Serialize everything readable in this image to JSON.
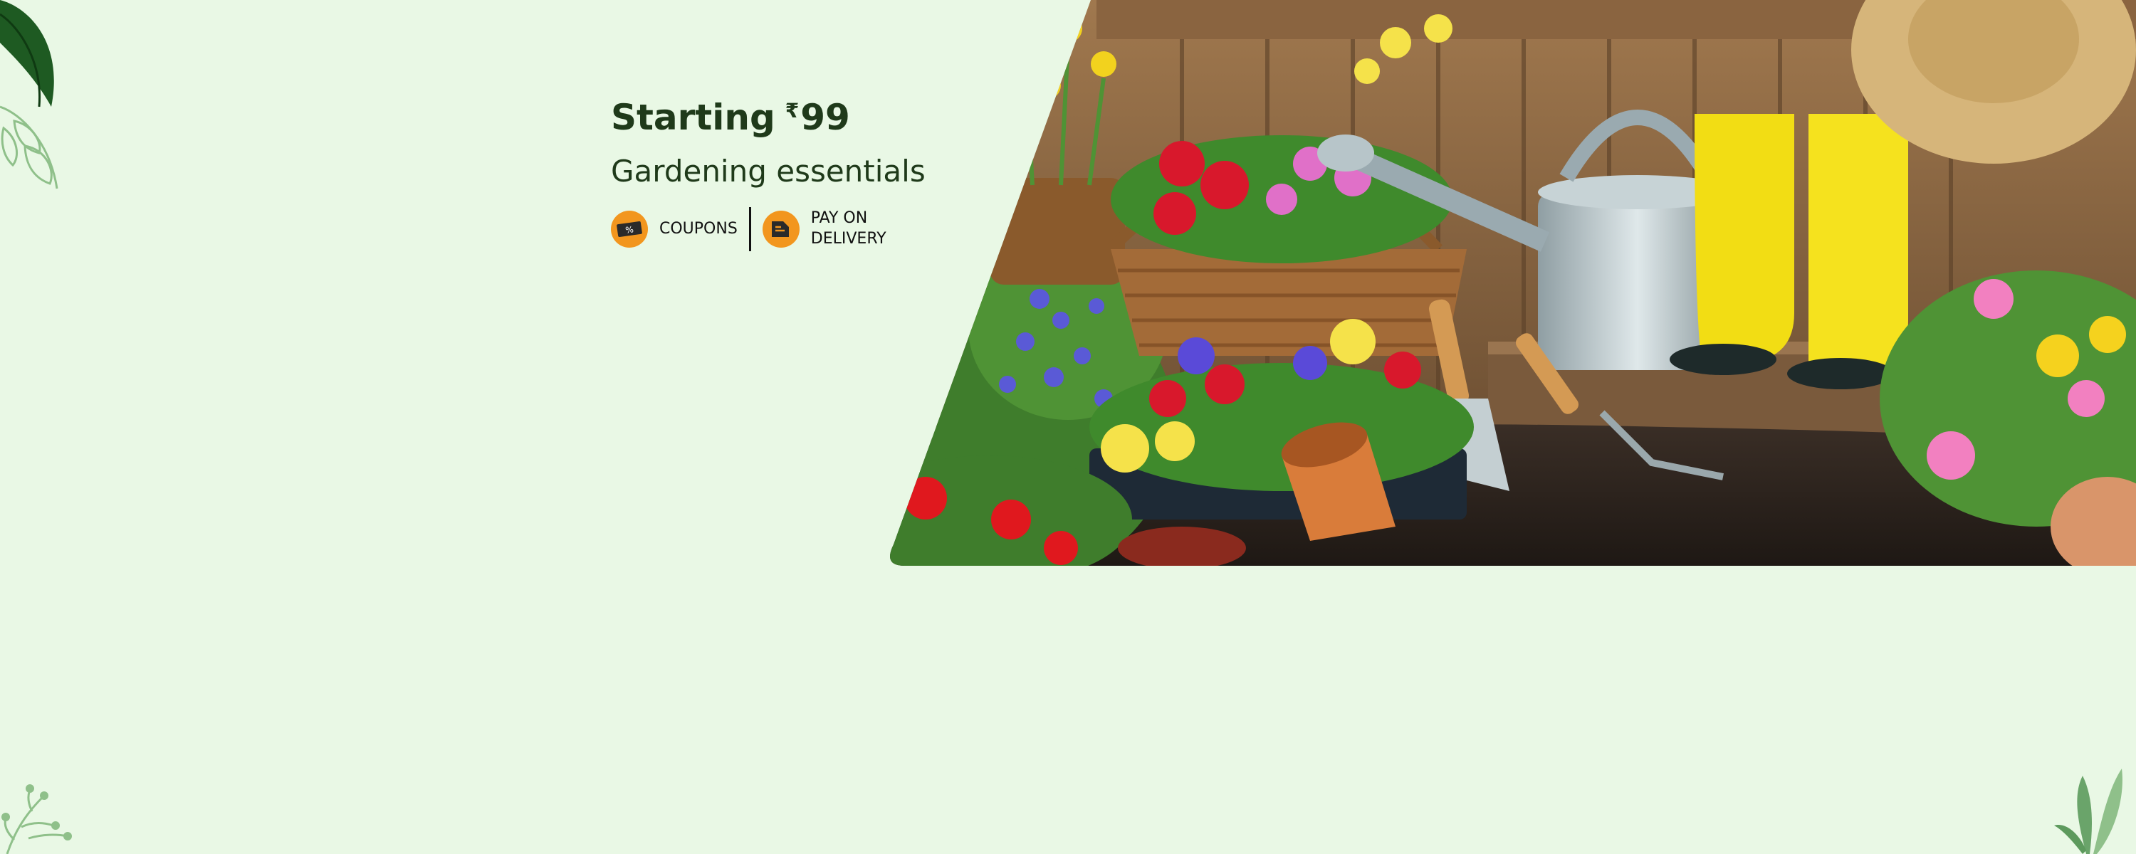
{
  "banner": {
    "headline_prefix": "Starting",
    "currency_symbol": "₹",
    "price": "99",
    "subtitle": "Gardening essentials",
    "badges": {
      "coupons": {
        "label": "COUPONS",
        "icon": "coupon-icon"
      },
      "pay_on_delivery": {
        "line1": "PAY ON",
        "line2": "DELIVERY",
        "icon": "pay-on-delivery-icon"
      }
    },
    "colors": {
      "background": "#e9f8e5",
      "text": "#1f3a1a",
      "badge": "#f2961e",
      "leaf_dark": "#1e5a22",
      "leaf_light": "#8fc08a"
    },
    "image": {
      "subject": "garden scene with flower basket, watering can, yellow rubber boots, trowel and rake, potted primulas, terracotta pot and soil"
    }
  }
}
